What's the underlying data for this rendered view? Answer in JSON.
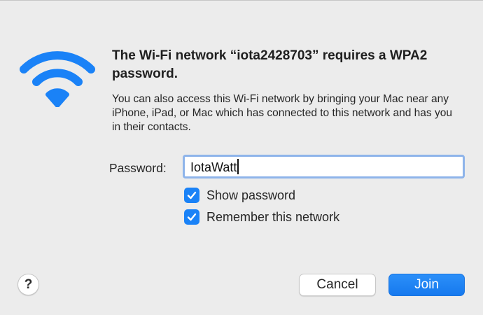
{
  "dialog": {
    "title": "The Wi-Fi network “iota2428703” requires a WPA2 password.",
    "message": "You can also access this Wi-Fi network by bringing your Mac near any iPhone, iPad, or Mac which has connected to this network and has you in their contacts."
  },
  "password": {
    "label": "Password:",
    "value": "IotaWatt"
  },
  "options": {
    "show_password": {
      "label": "Show password",
      "checked": true
    },
    "remember_network": {
      "label": "Remember this network",
      "checked": true
    }
  },
  "buttons": {
    "help": "?",
    "cancel": "Cancel",
    "join": "Join"
  },
  "icons": {
    "wifi": "wifi-icon",
    "checkmark": "checkmark-icon"
  },
  "colors": {
    "accent": "#1a82f7",
    "focus_ring": "#8eb4ea",
    "background": "#ececec"
  }
}
